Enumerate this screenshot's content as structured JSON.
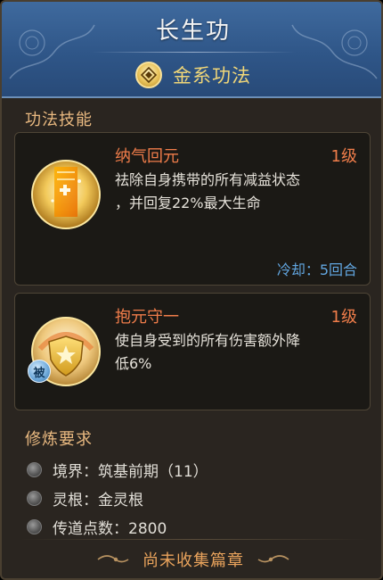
{
  "header": {
    "title": "长生功",
    "element_icon": "gold-element-icon",
    "element_label": "金系功法"
  },
  "skills_section": {
    "title": "功法技能",
    "skills": [
      {
        "name": "纳气回元",
        "level": "1级",
        "desc_line1": "祛除自身携带的所有减益状态",
        "desc_line2": "，并回复22%最大生命",
        "cooldown": "冷却：5回合",
        "icon": "healing-scroll-icon"
      },
      {
        "name": "抱元守一",
        "level": "1级",
        "desc_line1": "使自身受到的所有伤害额外降",
        "desc_line2": "低6%",
        "badge": "被",
        "icon": "shield-icon"
      }
    ]
  },
  "requirements": {
    "title": "修炼要求",
    "items": [
      {
        "label": "境界：筑基前期（11）"
      },
      {
        "label": "灵根：金灵根"
      },
      {
        "label": "传道点数：2800"
      }
    ]
  },
  "footer": {
    "label": "尚未收集篇章"
  },
  "colors": {
    "header_blue": "#2f5688",
    "skill_name_orange": "#f07d4a",
    "cooldown_blue": "#62a6e0",
    "section_title": "#e9b980",
    "element_gold": "#f0d678"
  }
}
